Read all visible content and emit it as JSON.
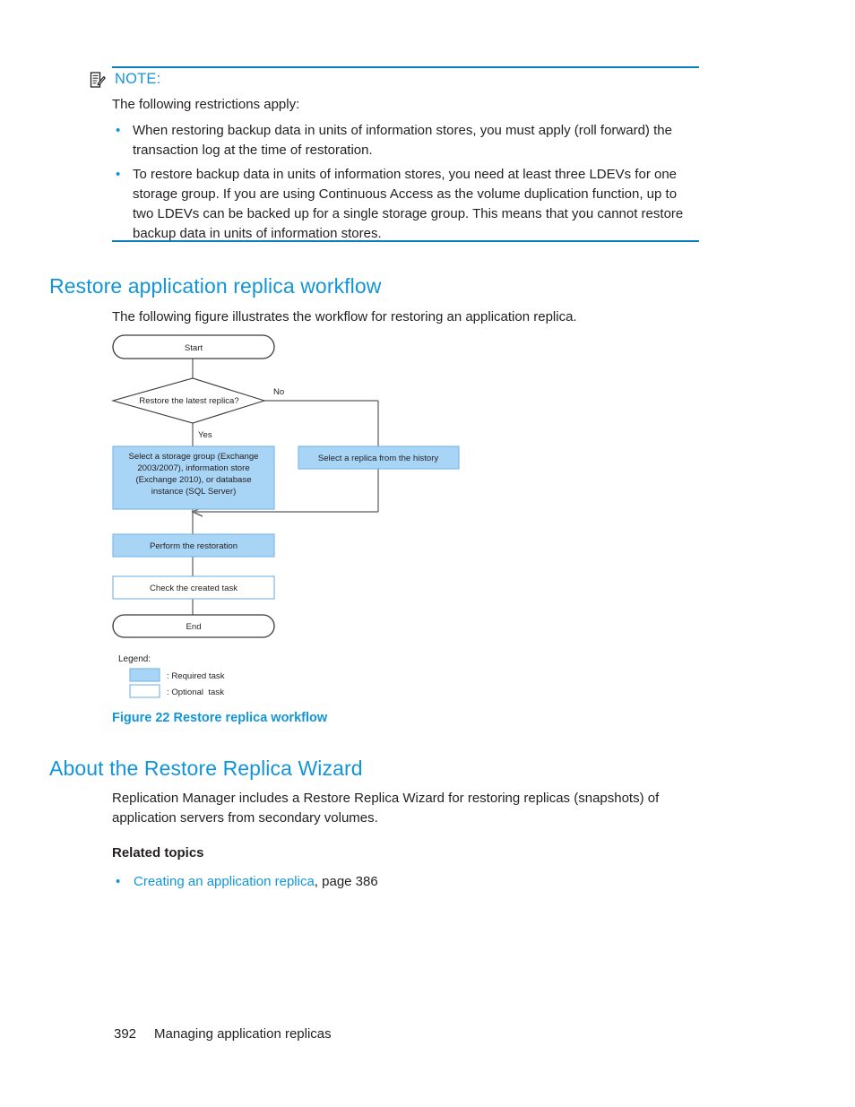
{
  "note": {
    "icon": "note-pen-icon",
    "title": "NOTE:",
    "intro": "The following restrictions apply:",
    "bullets": [
      "When restoring backup data in units of information stores, you must apply (roll forward) the transaction log at the time of restoration.",
      "To restore backup data in units of information stores, you need at least three LDEVs for one storage group. If you are using Continuous Access as the volume duplication function, up to two LDEVs can be backed up for a single storage group. This means that you cannot restore backup data in units of information stores."
    ]
  },
  "section_workflow": {
    "heading": "Restore application replica workflow",
    "intro": "The following figure illustrates the workflow for restoring an application replica."
  },
  "figure": {
    "caption": "Figure 22 Restore replica workflow",
    "colors": {
      "required_fill": "#a8d4f5",
      "optional_fill": "#ffffff",
      "box_border": "#7fb9e8",
      "terminator_border": "#3a3a3a",
      "connector": "#5a5a5a"
    },
    "nodes": {
      "start": "Start",
      "decision": "Restore the latest replica?",
      "branch_yes": "Yes",
      "branch_no": "No",
      "select_storage_group": "Select a storage group (Exchange 2003/2007), information store (Exchange 2010), or database instance (SQL Server)",
      "select_storage_group_lines": [
        "Select a storage group (Exchange",
        "2003/2007), information store",
        "(Exchange 2010), or database",
        "instance (SQL Server)"
      ],
      "select_replica_history": "Select a replica from the history",
      "perform_restoration": "Perform the restoration",
      "check_created_task": "Check the created task",
      "end": "End"
    },
    "legend": {
      "title": "Legend:",
      "items": [
        {
          "swatch": "required",
          "label": ": Required task"
        },
        {
          "swatch": "optional",
          "label": ": Optional  task"
        }
      ]
    }
  },
  "section_wizard": {
    "heading": "About the Restore Replica Wizard",
    "paragraph": "Replication Manager includes a Restore Replica Wizard for restoring replicas (snapshots) of application servers from secondary volumes.",
    "related_label": "Related topics",
    "related_items": [
      {
        "link": "Creating an application replica",
        "suffix": ", page 386"
      }
    ]
  },
  "footer": {
    "page_number": "392",
    "chapter": "Managing application replicas"
  }
}
